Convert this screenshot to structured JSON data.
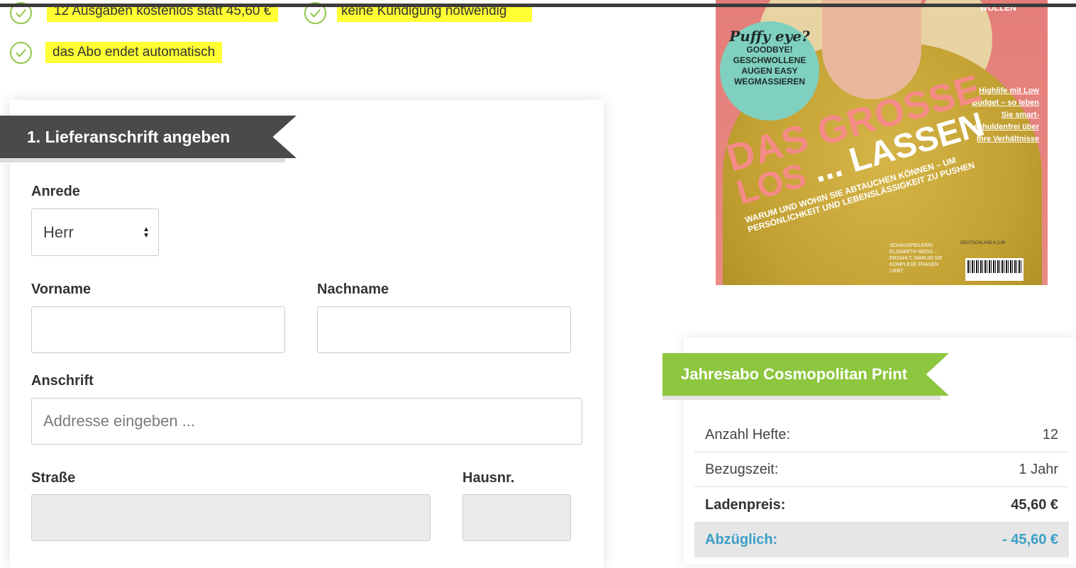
{
  "benefits": [
    {
      "text": "12 Ausgaben kostenlos statt 45,60 €"
    },
    {
      "text": "keine Kündigung notwendig"
    },
    {
      "text": "das Abo endet automatisch"
    }
  ],
  "form": {
    "section_title": "1. Lieferanschrift angeben",
    "salutation": {
      "label": "Anrede",
      "value": "Herr"
    },
    "first_name": {
      "label": "Vorname",
      "value": ""
    },
    "last_name": {
      "label": "Nachname",
      "value": ""
    },
    "address": {
      "label": "Anschrift",
      "placeholder": "Addresse eingeben ..."
    },
    "street": {
      "label": "Straße",
      "value": ""
    },
    "house_number": {
      "label": "Hausnr.",
      "value": ""
    }
  },
  "cover": {
    "top_word": "WOLLEN",
    "badge_script": "Puffy eye?",
    "badge_text": "GOODBYE! GESCHWOLLENE AUGEN EASY WEGMASSIEREN",
    "side_text": "Highlife mit Low Budget – so leben Sie smart-schuldenfrei über Ihre Verhältnisse",
    "headline_1": "DAS GROSSE",
    "headline_2a": "LOS",
    "headline_2b": "... LASSEN",
    "sub": "WARUM UND WOHIN SIE ABTAUCHEN KÖNNEN – UM PERSÖNLICHKEIT UND LEBENSLÄSSIGKEIT ZU PUSHEN",
    "bottom_small": "SCHAUSPIELERIN ELISABETH MOSS ... ERZÄHLT, WARUM SIE KOMPLEXE FRAUEN LIEBT",
    "price_small": "DEUTSCHLAND € 3,80"
  },
  "summary": {
    "title": "Jahresabo Cosmopolitan Print",
    "rows": [
      {
        "label": "Anzahl Hefte:",
        "value": "12"
      },
      {
        "label": "Bezugszeit:",
        "value": "1 Jahr"
      },
      {
        "label": "Ladenpreis:",
        "value": "45,60 €"
      },
      {
        "label": "Abzüglich:",
        "value": "- 45,60 €"
      }
    ]
  },
  "colors": {
    "highlight": "#ffff33",
    "check": "#8dc63f",
    "ribbon_dark": "#4a4a4a",
    "ribbon_green": "#8dc63f",
    "discount_blue": "#3a9fc7"
  }
}
